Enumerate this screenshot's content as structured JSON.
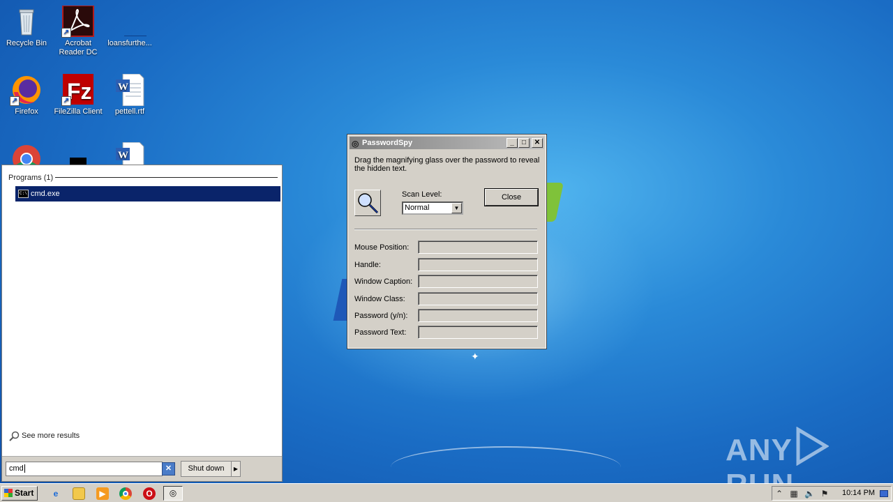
{
  "desktop": {
    "icons": [
      {
        "label": "Recycle Bin",
        "icon": "recycle-bin-icon"
      },
      {
        "label": "Acrobat\nReader DC",
        "icon": "acrobat-icon"
      },
      {
        "label": "loansfurthe...",
        "icon": "file-icon"
      },
      {
        "label": "Firefox",
        "icon": "firefox-icon"
      },
      {
        "label": "FileZilla Client",
        "icon": "filezilla-icon"
      },
      {
        "label": "pettell.rtf",
        "icon": "word-doc-icon"
      }
    ],
    "watermark": "ANY RUN"
  },
  "start_menu": {
    "section_header": "Programs (1)",
    "results": [
      {
        "label": "cmd.exe",
        "icon": "cmd-icon"
      }
    ],
    "see_more": "See more results",
    "search_value": "cmd",
    "shutdown_label": "Shut down"
  },
  "dialog": {
    "title": "PasswordSpy",
    "instructions": "Drag the magnifying glass over the password to reveal the hidden text.",
    "scan_level_label": "Scan Level:",
    "scan_level_value": "Normal",
    "close_label": "Close",
    "fields": [
      {
        "label": "Mouse Position:"
      },
      {
        "label": "Handle:"
      },
      {
        "label": "Window Caption:"
      },
      {
        "label": "Window Class:"
      },
      {
        "label": "Password (y/n):"
      },
      {
        "label": "Password Text:"
      }
    ]
  },
  "taskbar": {
    "start_label": "Start",
    "clock": "10:14 PM",
    "pinned": [
      "ie-icon",
      "explorer-icon",
      "media-player-icon",
      "chrome-icon",
      "opera-icon",
      "passwordspy-icon"
    ]
  }
}
